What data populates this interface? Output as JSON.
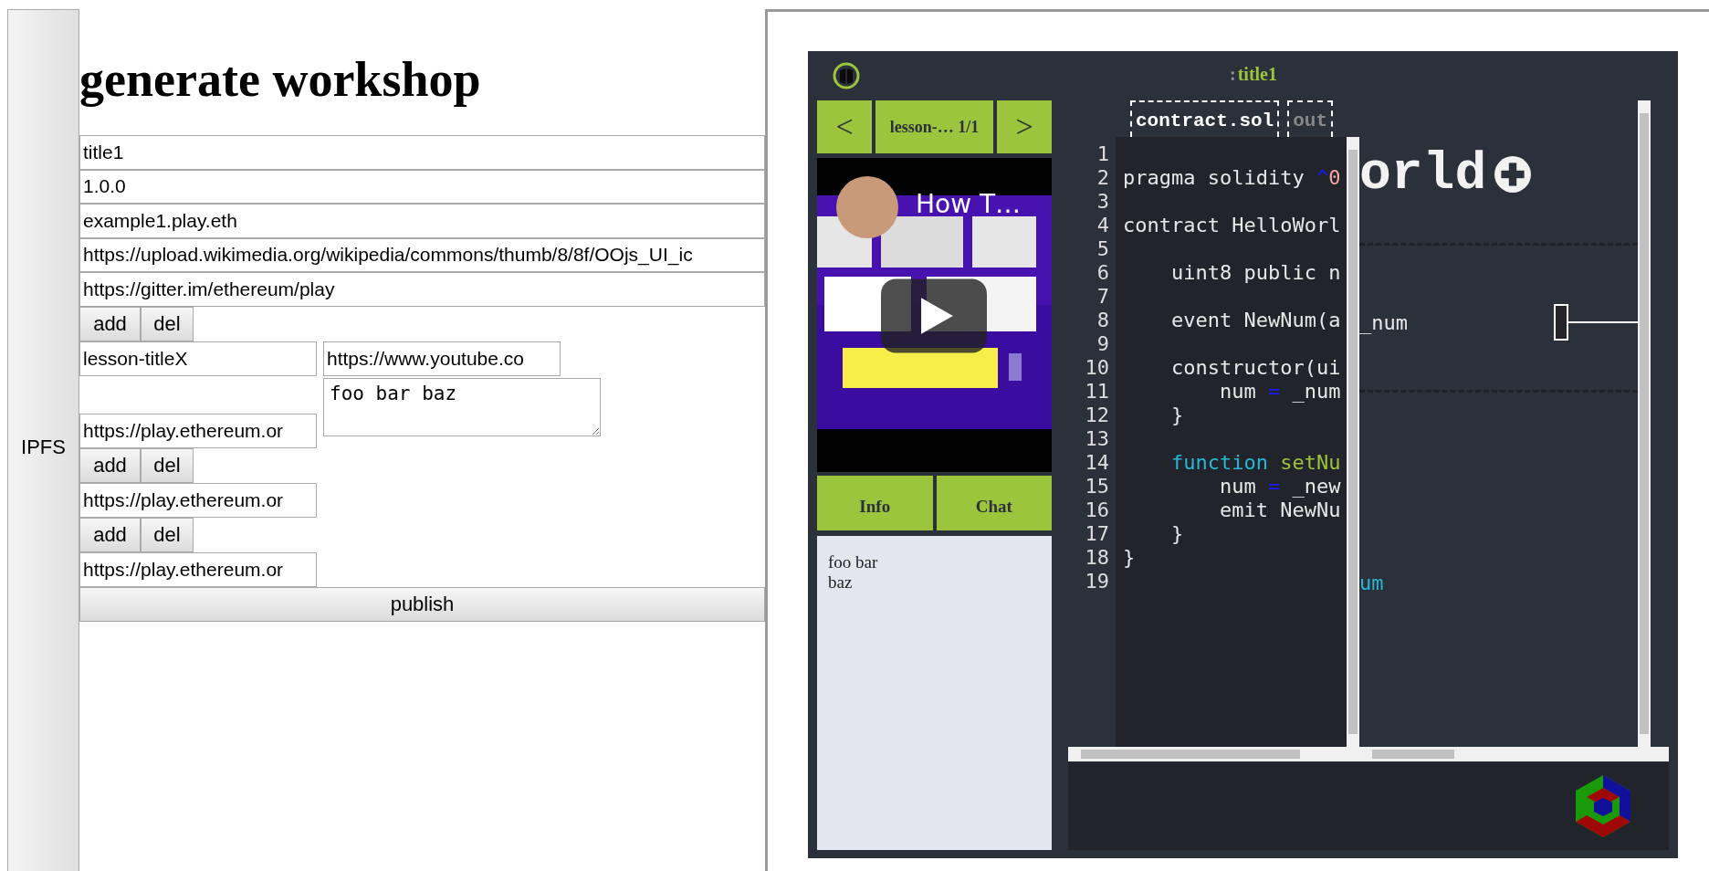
{
  "sidebar_button": "IPFS",
  "heading": "generate workshop",
  "fields": [
    "title1",
    "1.0.0",
    "example1.play.eth",
    "https://upload.wikimedia.org/wikipedia/commons/thumb/8/8f/OOjs_UI_ic",
    "https://gitter.im/ethereum/play"
  ],
  "lesson_buttons": [
    "add",
    "del"
  ],
  "lesson": {
    "title": "lesson-titleX",
    "video_url": "https://www.youtube.co",
    "description": "foo bar baz",
    "page_url": "https://play.ethereum.or"
  },
  "lesson_items": [
    {
      "kind": "buttons",
      "labels": [
        "add",
        "del"
      ]
    },
    {
      "kind": "url",
      "value": "https://play.ethereum.or"
    },
    {
      "kind": "buttons",
      "labels": [
        "add",
        "del"
      ]
    },
    {
      "kind": "url",
      "value": "https://play.ethereum.or"
    }
  ],
  "publish": "publish",
  "preview": {
    "title_prefix": ":",
    "title": "title1",
    "nav": {
      "prev": "<",
      "label": "lesson-… 1/1",
      "next": ">"
    },
    "video": {
      "kind": "picture",
      "overlay_title": "How T…"
    },
    "tabs": [
      "Info",
      "Chat"
    ],
    "info_text": "foo bar\nbaz",
    "editor": {
      "tabs": [
        {
          "label": "contract.sol",
          "selected": true
        },
        {
          "label": "out",
          "selected": false
        }
      ],
      "lines": [
        {
          "number": "1"
        },
        {
          "number": "2",
          "tokens": [
            {
              "text": "pragma solidity ",
              "kind": "text"
            },
            {
              "text": "^",
              "kind": "op"
            },
            {
              "text": "0",
              "kind": "num"
            }
          ]
        },
        {
          "number": "3"
        },
        {
          "number": "4",
          "tokens": [
            {
              "text": "contract HelloWorl",
              "kind": "text"
            }
          ]
        },
        {
          "number": "5"
        },
        {
          "number": "6",
          "tokens": [
            {
              "text": "    uint8 public n",
              "kind": "text"
            }
          ]
        },
        {
          "number": "7"
        },
        {
          "number": "8",
          "tokens": [
            {
              "text": "    event NewNum(a",
              "kind": "text"
            }
          ]
        },
        {
          "number": "9"
        },
        {
          "number": "10",
          "tokens": [
            {
              "text": "    constructor(ui",
              "kind": "text"
            }
          ]
        },
        {
          "number": "11",
          "tokens": [
            {
              "text": "        num ",
              "kind": "text"
            },
            {
              "text": "=",
              "kind": "op"
            },
            {
              "text": " _num",
              "kind": "text"
            }
          ]
        },
        {
          "number": "12",
          "tokens": [
            {
              "text": "    }",
              "kind": "text"
            }
          ]
        },
        {
          "number": "13"
        },
        {
          "number": "14",
          "tokens": [
            {
              "text": "    function ",
              "kind": "keyword"
            },
            {
              "text": "setNu",
              "kind": "name"
            }
          ]
        },
        {
          "number": "15",
          "tokens": [
            {
              "text": "        num ",
              "kind": "text"
            },
            {
              "text": "=",
              "kind": "op"
            },
            {
              "text": " _new",
              "kind": "text"
            }
          ]
        },
        {
          "number": "16",
          "tokens": [
            {
              "text": "        emit NewNu",
              "kind": "text"
            }
          ]
        },
        {
          "number": "17",
          "tokens": [
            {
              "text": "    }",
              "kind": "text"
            }
          ]
        },
        {
          "number": "18",
          "tokens": [
            {
              "text": "}",
              "kind": "text"
            }
          ]
        },
        {
          "number": "19"
        }
      ]
    },
    "output": {
      "heading": "orld",
      "param": "_num",
      "trailing": "um"
    }
  }
}
